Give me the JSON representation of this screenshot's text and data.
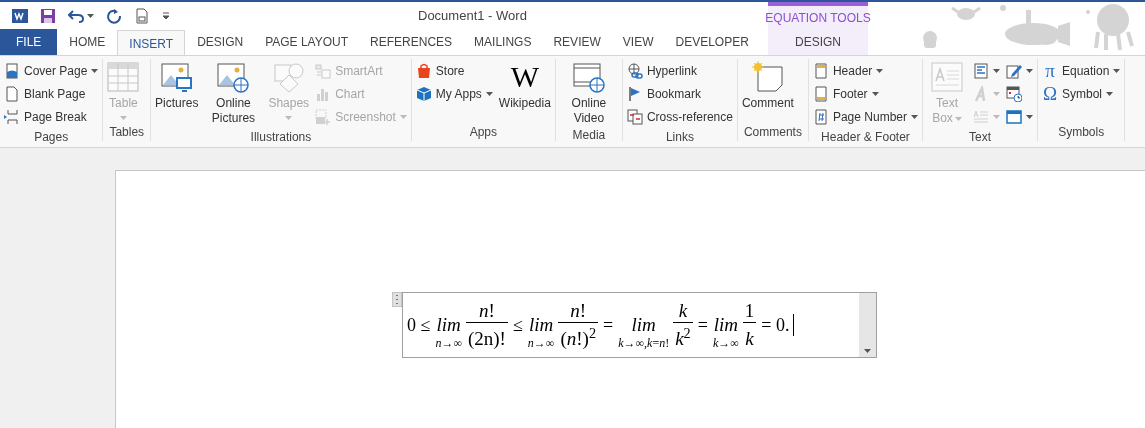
{
  "window": {
    "title": "Document1 - Word"
  },
  "contextual": {
    "label": "EQUATION TOOLS"
  },
  "tabs": [
    {
      "label": "FILE",
      "kind": "file",
      "selected": false
    },
    {
      "label": "HOME",
      "kind": "main",
      "selected": false
    },
    {
      "label": "INSERT",
      "kind": "main",
      "selected": true
    },
    {
      "label": "DESIGN",
      "kind": "main",
      "selected": false
    },
    {
      "label": "PAGE LAYOUT",
      "kind": "main",
      "selected": false
    },
    {
      "label": "REFERENCES",
      "kind": "main",
      "selected": false
    },
    {
      "label": "MAILINGS",
      "kind": "main",
      "selected": false
    },
    {
      "label": "REVIEW",
      "kind": "main",
      "selected": false
    },
    {
      "label": "VIEW",
      "kind": "main",
      "selected": false
    },
    {
      "label": "DEVELOPER",
      "kind": "main",
      "selected": false
    },
    {
      "label": "DESIGN",
      "kind": "contextual",
      "selected": false
    }
  ],
  "ribbon_groups": [
    {
      "label": "Pages",
      "columns": [
        [
          {
            "kind": "small",
            "label": "Cover Page",
            "dropdown": true,
            "disabled": false
          },
          {
            "kind": "small",
            "label": "Blank Page",
            "dropdown": false,
            "disabled": false
          },
          {
            "kind": "small",
            "label": "Page Break",
            "dropdown": false,
            "disabled": false
          }
        ]
      ]
    },
    {
      "label": "Tables",
      "columns": [
        [
          {
            "kind": "large",
            "label": "Table",
            "dropdown": true,
            "disabled": true
          }
        ]
      ]
    },
    {
      "label": "Illustrations",
      "columns": [
        [
          {
            "kind": "large",
            "label": "Pictures",
            "dropdown": false,
            "disabled": false
          }
        ],
        [
          {
            "kind": "large",
            "label": "Online Pictures",
            "dropdown": false,
            "disabled": false
          }
        ],
        [
          {
            "kind": "large",
            "label": "Shapes",
            "dropdown": true,
            "disabled": true
          }
        ],
        [
          {
            "kind": "small",
            "label": "SmartArt",
            "dropdown": false,
            "disabled": true
          },
          {
            "kind": "small",
            "label": "Chart",
            "dropdown": false,
            "disabled": true
          },
          {
            "kind": "small",
            "label": "Screenshot",
            "dropdown": true,
            "disabled": true
          }
        ]
      ]
    },
    {
      "label": "Apps",
      "columns": [
        [
          {
            "kind": "small",
            "label": "Store",
            "dropdown": false,
            "disabled": false
          },
          {
            "kind": "small",
            "label": "My Apps",
            "dropdown": true,
            "disabled": false
          }
        ],
        [
          {
            "kind": "large",
            "label": "Wikipedia",
            "icon_text": "W",
            "dropdown": false,
            "disabled": false
          }
        ]
      ]
    },
    {
      "label": "Media",
      "columns": [
        [
          {
            "kind": "large",
            "label": "Online Video",
            "dropdown": false,
            "disabled": false
          }
        ]
      ]
    },
    {
      "label": "Links",
      "columns": [
        [
          {
            "kind": "small",
            "label": "Hyperlink",
            "dropdown": false,
            "disabled": false
          },
          {
            "kind": "small",
            "label": "Bookmark",
            "dropdown": false,
            "disabled": false
          },
          {
            "kind": "small",
            "label": "Cross-reference",
            "dropdown": false,
            "disabled": false
          }
        ]
      ]
    },
    {
      "label": "Comments",
      "columns": [
        [
          {
            "kind": "large",
            "label": "Comment",
            "dropdown": false,
            "disabled": false
          }
        ]
      ]
    },
    {
      "label": "Header & Footer",
      "columns": [
        [
          {
            "kind": "small",
            "label": "Header",
            "dropdown": true,
            "disabled": false
          },
          {
            "kind": "small",
            "label": "Footer",
            "dropdown": true,
            "disabled": false
          },
          {
            "kind": "small",
            "label": "Page Number",
            "dropdown": true,
            "disabled": false
          }
        ]
      ]
    },
    {
      "label": "Text",
      "columns": [
        [
          {
            "kind": "stacked",
            "label": "Text Box",
            "dropdown": true,
            "disabled": true
          }
        ],
        [
          {
            "kind": "icon",
            "dropdown": true,
            "disabled": false
          },
          {
            "kind": "icon",
            "dropdown": true,
            "disabled": true
          },
          {
            "kind": "icon",
            "dropdown": true,
            "disabled": true
          }
        ],
        [
          {
            "kind": "icon",
            "dropdown": true,
            "disabled": false
          },
          {
            "kind": "icon",
            "dropdown": false,
            "disabled": false
          },
          {
            "kind": "icon",
            "dropdown": true,
            "disabled": false
          }
        ]
      ]
    },
    {
      "label": "Symbols",
      "columns": [
        [
          {
            "kind": "small",
            "label": "Equation",
            "icon_text": "π",
            "dropdown": true,
            "disabled": false
          },
          {
            "kind": "small",
            "label": "Symbol",
            "icon_text": "Ω",
            "dropdown": true,
            "disabled": false
          }
        ]
      ]
    }
  ],
  "equation": {
    "parts": [
      {
        "kind": "text",
        "text": "0 ≤"
      },
      {
        "kind": "limit",
        "word": "lim",
        "sub": "*n*→∞"
      },
      {
        "kind": "fraction",
        "num": "*n*!",
        "den": "(2n)!"
      },
      {
        "kind": "text",
        "text": "≤"
      },
      {
        "kind": "limit",
        "word": "lim",
        "sub": "*n*→∞"
      },
      {
        "kind": "fraction",
        "num": "*n*!",
        "den": "(*n*!)$^{2}$"
      },
      {
        "kind": "text",
        "text": "="
      },
      {
        "kind": "limit",
        "word": "lim",
        "sub": "*k*→∞,*k*=*n*!"
      },
      {
        "kind": "fraction",
        "num": "*k*",
        "den": "*k*$^{2}$"
      },
      {
        "kind": "text",
        "text": "="
      },
      {
        "kind": "limit",
        "word": "lim",
        "sub": "*k*→∞"
      },
      {
        "kind": "fraction",
        "num": "1",
        "den": "*k*"
      },
      {
        "kind": "text",
        "text": "= 0."
      }
    ]
  }
}
